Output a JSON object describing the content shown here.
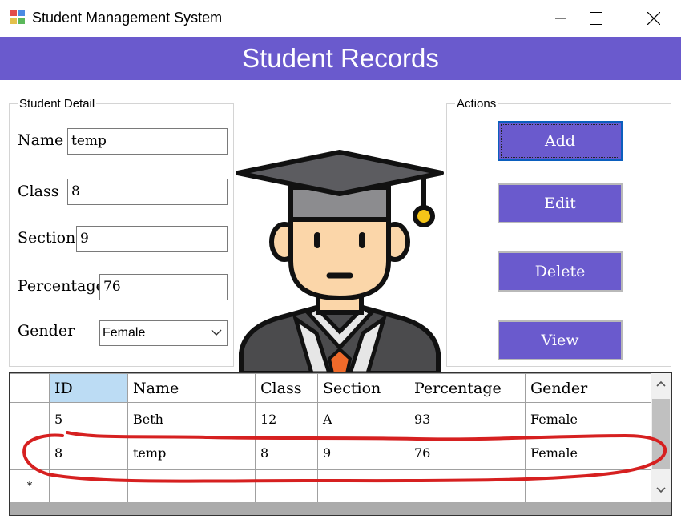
{
  "window": {
    "title": "Student Management System",
    "controls": [
      "minimize-icon",
      "maximize-icon",
      "close-icon"
    ]
  },
  "banner": {
    "title": "Student Records"
  },
  "student_detail": {
    "legend": "Student Detail",
    "name_label": "Name",
    "name_value": "temp",
    "class_label": "Class",
    "class_value": "8",
    "section_label": "Section",
    "section_value": "9",
    "percentage_label": "Percentage",
    "percentage_value": "76",
    "gender_label": "Gender",
    "gender_value": "Female"
  },
  "actions": {
    "legend": "Actions",
    "add": "Add",
    "edit": "Edit",
    "delete": "Delete",
    "view": "View"
  },
  "grid": {
    "columns": [
      "ID",
      "Name",
      "Class",
      "Section",
      "Percentage",
      "Gender"
    ],
    "rows": [
      [
        "5",
        "Beth",
        "12",
        "A",
        "93",
        "Female"
      ],
      [
        "8",
        "temp",
        "8",
        "9",
        "76",
        "Female"
      ]
    ],
    "new_row_marker": "*"
  },
  "colors": {
    "accent": "#6a5acd",
    "annotation": "#d62020",
    "selected_header": "#bcdcf4"
  }
}
